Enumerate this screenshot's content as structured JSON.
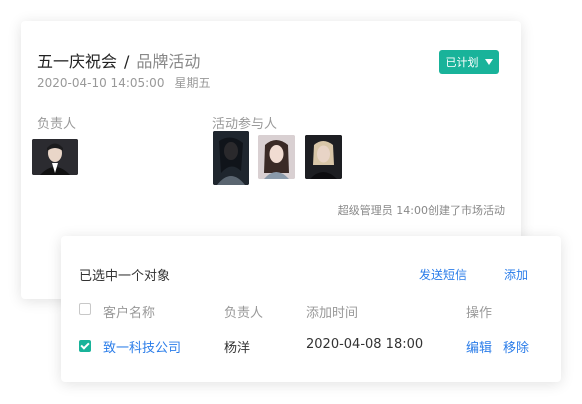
{
  "event": {
    "title": "五一庆祝会",
    "separator": "/",
    "category": "品牌活动",
    "date": "2020-04-10 14:05:00",
    "weekday": "星期五",
    "status_label": "已计划"
  },
  "owner_section": {
    "label": "负责人"
  },
  "participants_section": {
    "label": "活动参与人"
  },
  "activity_log": "超级管理员 14:00创建了市场活动",
  "selection_panel": {
    "title": "已选中一个对象",
    "send_sms": "发送短信",
    "add": "添加",
    "columns": [
      "客户名称",
      "负责人",
      "添加时间",
      "操作"
    ],
    "rows": [
      {
        "name": "致一科技公司",
        "owner": "杨洋",
        "added": "2020-04-08 18:00",
        "edit": "编辑",
        "remove": "移除",
        "checked": true
      }
    ]
  },
  "colors": {
    "accent": "#19b39a",
    "link": "#2b7de9"
  }
}
